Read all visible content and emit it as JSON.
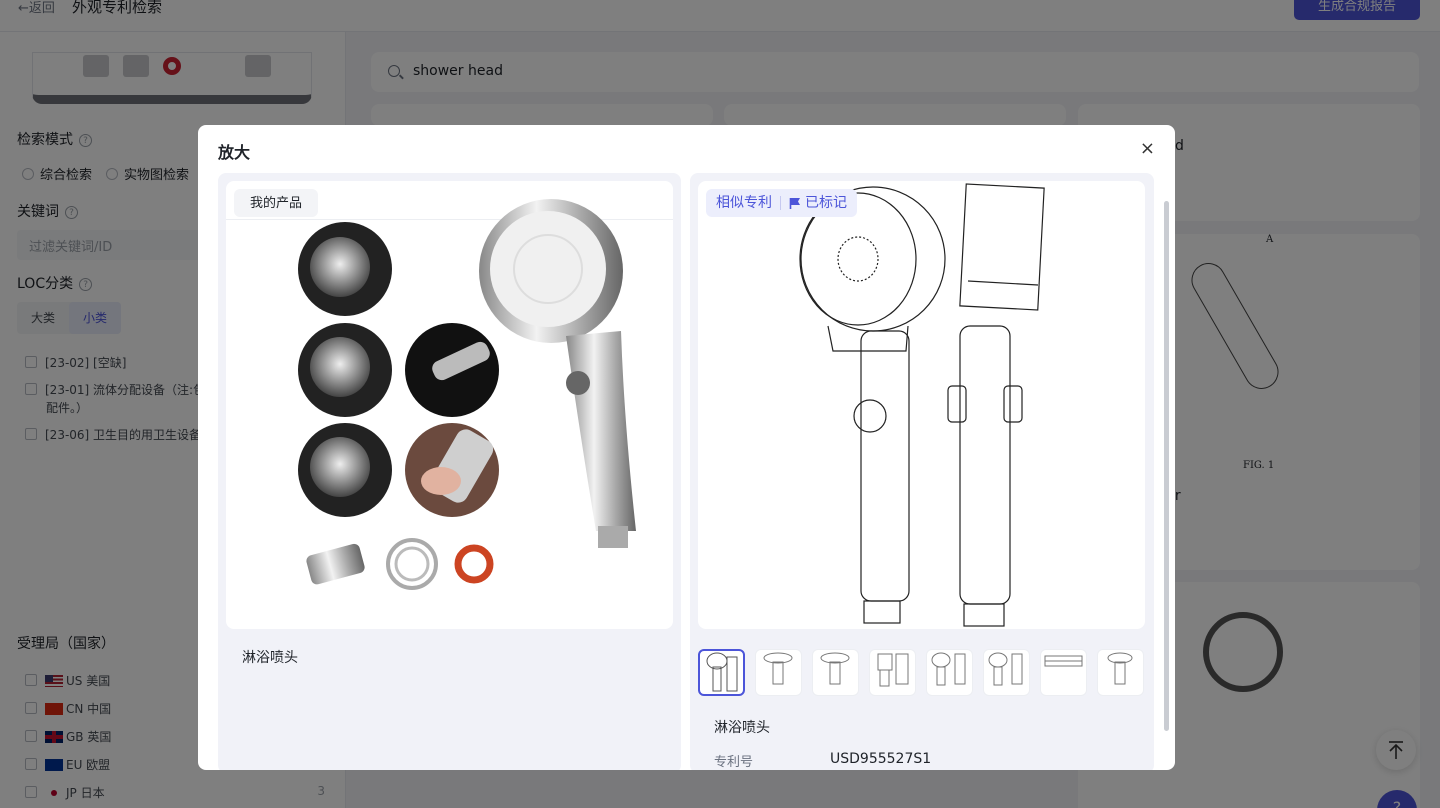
{
  "header": {
    "back_label": "←返回",
    "title": "外观专利检索",
    "report_button": "生成合规报告"
  },
  "sidebar": {
    "search_mode_label": "检索模式",
    "modes": [
      "综合检索",
      "实物图检索"
    ],
    "keyword_label": "关键词",
    "keyword_placeholder": "过滤关键词/ID",
    "loc_label": "LOC分类",
    "loc_tabs": [
      "大类",
      "小类"
    ],
    "loc_items": [
      "[23-02] [空缺]",
      "[23-01] 流体分配设备（注:包",
      "配件。）",
      "[23-06] 卫生目的用卫生设备"
    ],
    "office_label": "受理局（国家）",
    "offices": [
      {
        "code": "US 美国",
        "count": ""
      },
      {
        "code": "CN 中国",
        "count": ""
      },
      {
        "code": "GB 英国",
        "count": ""
      },
      {
        "code": "EU 欧盟",
        "count": ""
      },
      {
        "code": "JP 日本",
        "count": "3"
      }
    ]
  },
  "search": {
    "query": "shower head"
  },
  "results": {
    "card_title_a": "d",
    "card_title_b": "yer",
    "fig_label": "FIG. 1",
    "fig_letter": "A"
  },
  "modal": {
    "title": "放大",
    "close_icon": "×",
    "my_product_tag": "我的产品",
    "product_name": "淋浴喷头",
    "similar_tag": "相似专利",
    "marked_tag": "已标记",
    "patent_name": "淋浴喷头",
    "patent_no_label": "专利号",
    "patent_no": "USD955527S1",
    "thumbnails": 8
  },
  "colors": {
    "accent": "#4c55d9",
    "mask": "rgba(0,0,0,0.5)"
  }
}
